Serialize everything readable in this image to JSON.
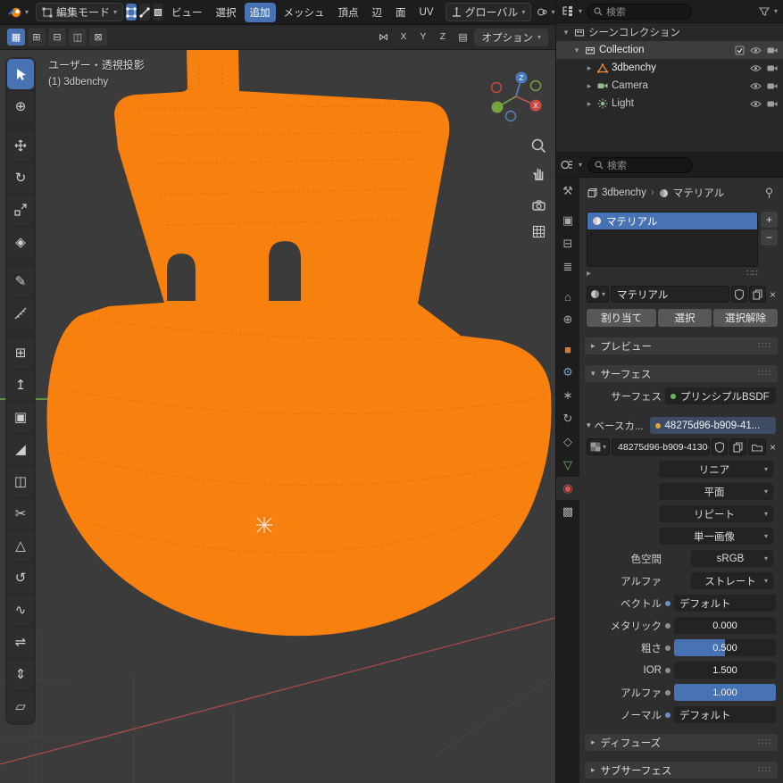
{
  "topbar": {
    "mode_label": "編集モード",
    "menus": [
      "ビュー",
      "選択",
      "追加",
      "メッシュ",
      "頂点",
      "辺",
      "面",
      "UV"
    ],
    "orientation": "グローバル",
    "tool_settings": {
      "mirror_axes": [
        "X",
        "Y",
        "Z"
      ],
      "options_label": "オプション"
    }
  },
  "viewport": {
    "view_label": "ユーザー・透視投影",
    "object_label": "(1) 3dbenchy",
    "gizmo": {
      "x": "X",
      "z": "Z"
    }
  },
  "outliner": {
    "search_placeholder": "検索",
    "scene_collection_label": "シーンコレクション",
    "collection_label": "Collection",
    "items": [
      {
        "label": "3dbenchy"
      },
      {
        "label": "Camera"
      },
      {
        "label": "Light"
      }
    ]
  },
  "properties": {
    "search_placeholder": "検索",
    "breadcrumb_object": "3dbenchy",
    "breadcrumb_material": "マテリアル",
    "slot_name": "マテリアル",
    "name_field": "マテリアル",
    "assign": "割り当て",
    "select": "選択",
    "deselect": "選択解除",
    "preview_section": "プレビュー",
    "surface_section": "サーフェス",
    "surface_label": "サーフェス",
    "surface_value": "プリンシプルBSDF",
    "base_color_label": "ベースカ...",
    "base_color_value": "48275d96-b909-41...",
    "image_name": "48275d96-b909-4130-...",
    "interpolation": "リニア",
    "projection": "平面",
    "extension": "リピート",
    "source": "単一画像",
    "color_space_label": "色空間",
    "color_space_value": "sRGB",
    "alpha_mode_label": "アルファ",
    "alpha_mode_value": "ストレート",
    "vector_label": "ベクトル",
    "vector_value": "デフォルト",
    "sliders": [
      {
        "label": "メタリック",
        "value": "0.000",
        "fill": 0
      },
      {
        "label": "粗さ",
        "value": "0.500",
        "fill": 0.5
      },
      {
        "label": "IOR",
        "value": "1.500",
        "fill": 0
      },
      {
        "label": "アルファ",
        "value": "1.000",
        "fill": 1
      }
    ],
    "normal_label": "ノーマル",
    "normal_value": "デフォルト",
    "diffuse_section": "ディフューズ",
    "subsurface_section": "サブサーフェス"
  },
  "colors": {
    "accent": "#4772b3",
    "object_orange": "#f8800f",
    "axis_x_red": "#b34c4c",
    "axis_y_green": "#6faa4c"
  }
}
